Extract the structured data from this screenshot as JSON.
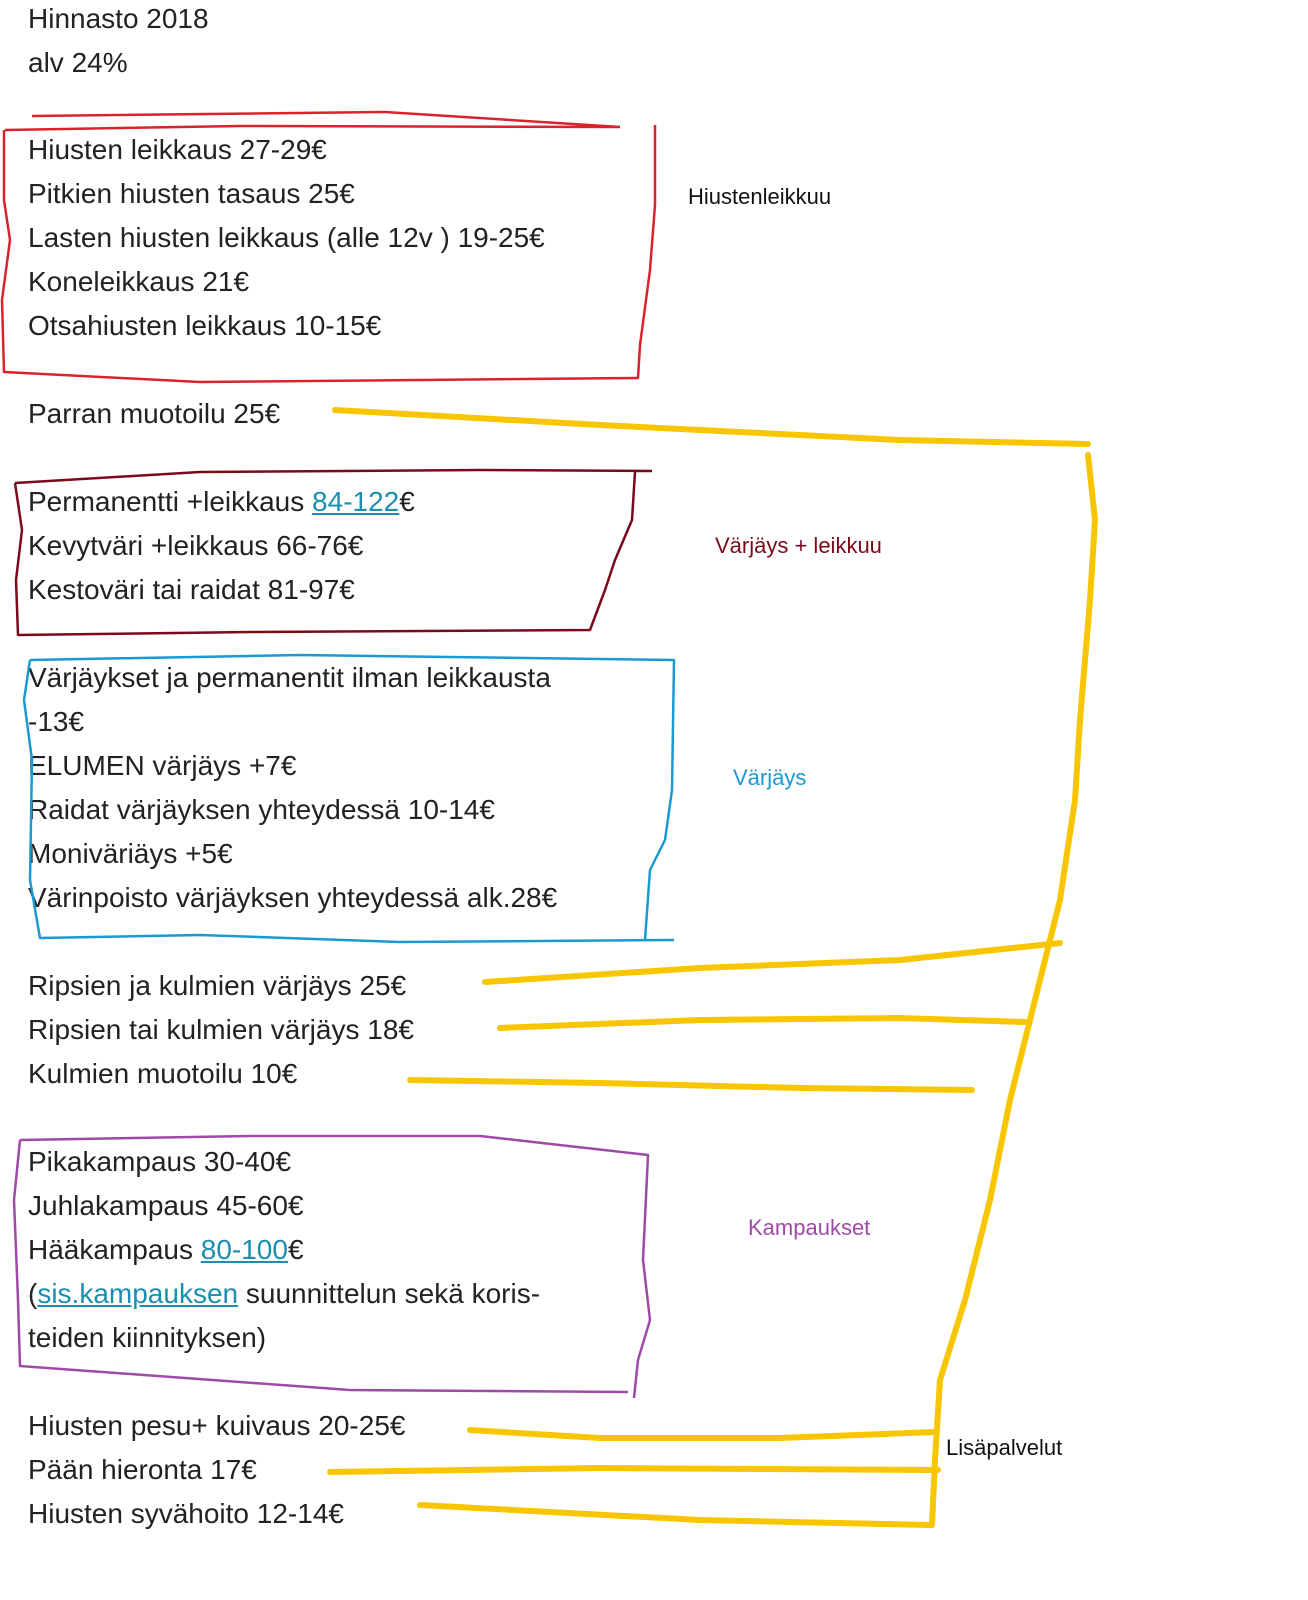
{
  "header": {
    "title": "Hinnasto 2018",
    "vat": "alv 24%"
  },
  "colors": {
    "red": "#d8232a",
    "maroon": "#7a0a1a",
    "blue": "#1a9ad0",
    "purple": "#a04aa8",
    "yellow": "#f7c600"
  },
  "sections": {
    "haircut": {
      "label": "Hiustenleikkuu",
      "items": [
        "Hiusten leikkaus 27-29€",
        "Pitkien hiusten tasaus 25€",
        "Lasten hiusten leikkaus (alle 12v ) 19-25€",
        "Koneleikkaus  21€",
        "Otsahiusten leikkaus 10-15€"
      ]
    },
    "beard": {
      "item": "Parran muotoilu 25€"
    },
    "color_cut": {
      "label": "Värjäys + leikkuu",
      "perm_prefix": "Permanentti +leikkaus ",
      "perm_link": "84-122",
      "perm_suffix": "€",
      "items": [
        "Kevytväri +leikkaus 66-76€",
        "Kestoväri tai raidat 81-97€"
      ]
    },
    "color": {
      "label": "Värjäys",
      "items": [
        "Värjäykset ja permanentit ilman leikkausta",
        "-13€",
        "ELUMEN värjäys  +7€",
        "Raidat värjäyksen yhteydessä  10-14€",
        "Moniväriäys  +5€",
        "Värinpoisto värjäyksen yhteydessä alk.28€"
      ]
    },
    "lashes": {
      "items": [
        "Ripsien ja kulmien värjäys  25€",
        "Ripsien tai kulmien värjäys  18€",
        "Kulmien muotoilu  10€"
      ]
    },
    "styling": {
      "label": "Kampaukset",
      "items": [
        "Pikakampaus  30-40€",
        "Juhlakampaus  45-60€"
      ],
      "wedding_prefix": "Hääkampaus  ",
      "wedding_link": "80-100",
      "wedding_suffix": "€",
      "note_prefix": " (",
      "note_link": "sis.kampauksen",
      "note_rest": " suunnittelun sekä koris-",
      "note_line2": "teiden kiinnityksen)"
    },
    "extras": {
      "label": "Lisäpalvelut",
      "items": [
        "Hiusten pesu+ kuivaus  20-25€",
        "Pään hieronta  17€",
        "Hiusten syvähoito  12-14€"
      ]
    }
  }
}
